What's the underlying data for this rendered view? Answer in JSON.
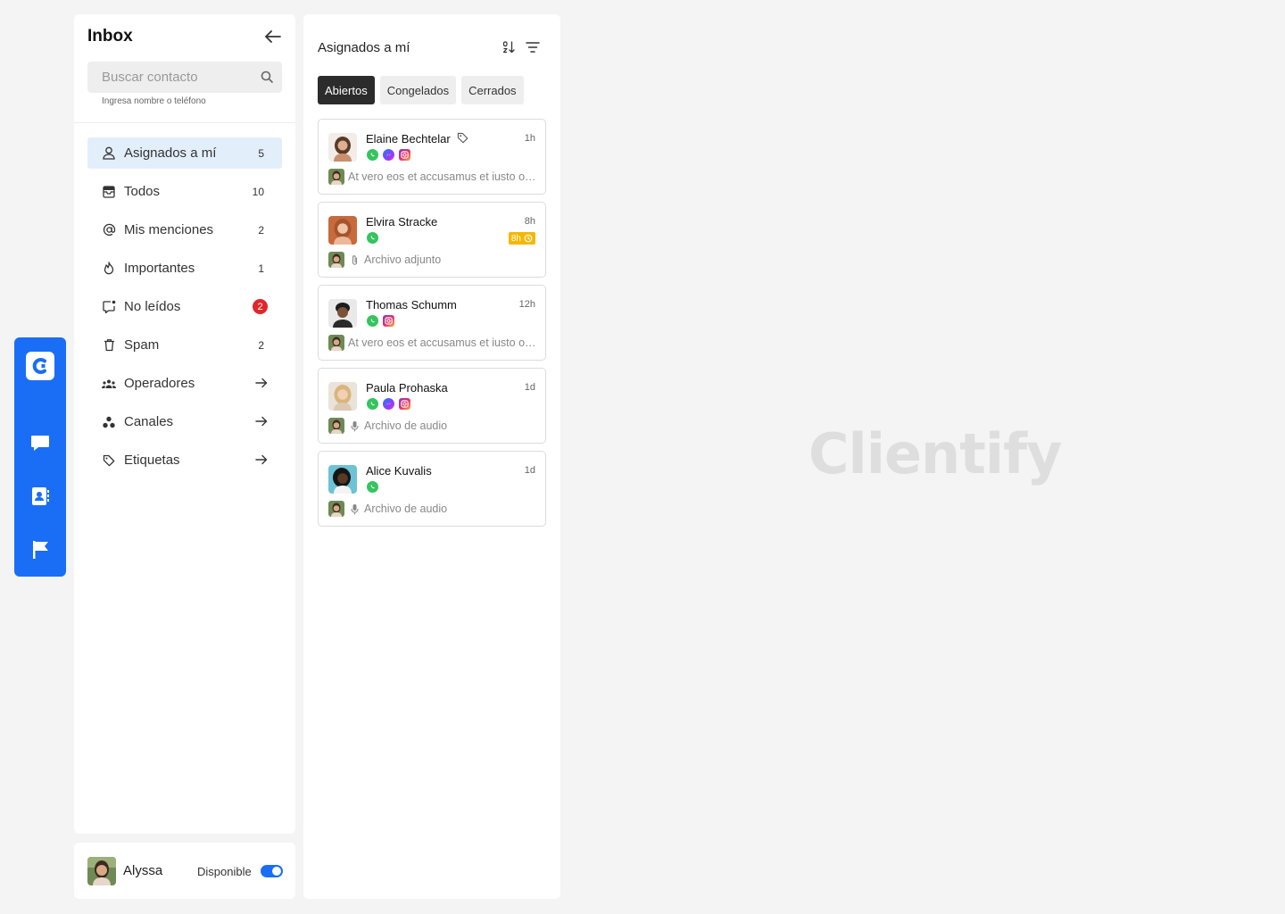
{
  "rail": {
    "items": [
      {
        "icon": "chat-icon"
      },
      {
        "icon": "contacts-icon"
      },
      {
        "icon": "flag-icon"
      }
    ]
  },
  "sidebar": {
    "title": "Inbox",
    "search_placeholder": "Buscar contacto",
    "search_hint": "Ingresa nombre o teléfono",
    "items": [
      {
        "label": "Asignados a mí",
        "count": "5"
      },
      {
        "label": "Todos",
        "count": "10"
      },
      {
        "label": "Mis menciones",
        "count": "2"
      },
      {
        "label": "Importantes",
        "count": "1"
      },
      {
        "label": "No leídos",
        "count": "2"
      },
      {
        "label": "Spam",
        "count": "2"
      },
      {
        "label": "Operadores"
      },
      {
        "label": "Canales"
      },
      {
        "label": "Etiquetas"
      }
    ]
  },
  "user": {
    "name": "Alyssa",
    "status": "Disponible"
  },
  "list": {
    "title": "Asignados a mí",
    "tabs": [
      "Abiertos",
      "Congelados",
      "Cerrados"
    ],
    "conversations": [
      {
        "name": "Elaine Bechtelar",
        "time": "1h",
        "channels": [
          "whatsapp",
          "messenger",
          "instagram"
        ],
        "preview": "At vero eos et accusamus et iusto odio dignissimos",
        "tagged": true
      },
      {
        "name": "Elvira Stracke",
        "time": "8h",
        "channels": [
          "whatsapp"
        ],
        "preview": "Archivo adjunto",
        "sla": "8h"
      },
      {
        "name": "Thomas Schumm",
        "time": "12h",
        "channels": [
          "whatsapp",
          "instagram"
        ],
        "preview": "At vero eos et accusamus et iusto odio dignissimos"
      },
      {
        "name": "Paula Prohaska",
        "time": "1d",
        "channels": [
          "whatsapp",
          "messenger",
          "instagram"
        ],
        "preview": "Archivo de audio"
      },
      {
        "name": "Alice Kuvalis",
        "time": "1d",
        "channels": [
          "whatsapp"
        ],
        "preview": "Archivo de audio"
      }
    ]
  },
  "brand": {
    "watermark": "Clientify"
  },
  "colors": {
    "accent": "#1a6ef5",
    "active_bg": "#e3eefb",
    "badge": "#e0262b",
    "sla": "#f5b800"
  }
}
